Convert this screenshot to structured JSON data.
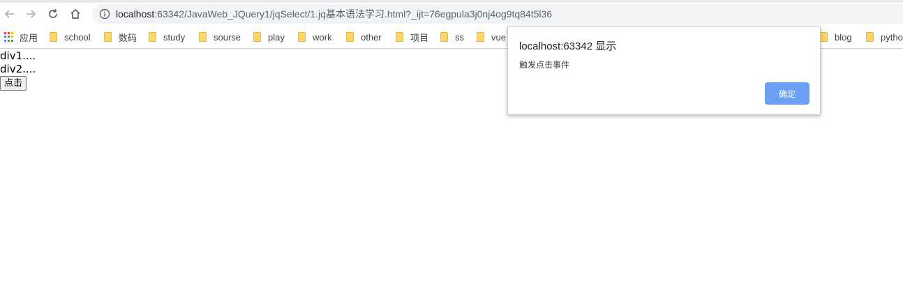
{
  "browser": {
    "url_host": "localhost",
    "url_rest": ":63342/JavaWeb_JQuery1/jqSelect/1.jq基本语法学习.html?_ijt=76egpula3j0nj4og9tq84t5l36",
    "back_icon": "arrow-left-icon",
    "forward_icon": "arrow-right-icon",
    "reload_icon": "reload-icon",
    "home_icon": "home-icon",
    "info_icon": "info-icon"
  },
  "bookmarks": {
    "apps_label": "应用",
    "items": [
      "school",
      "数码",
      "study",
      "sourse",
      "play",
      "work",
      "other",
      "项目",
      "ss",
      "vue",
      "blog",
      "pytho"
    ]
  },
  "page": {
    "div1": "div1....",
    "div2": "div2....",
    "button_label": "点击"
  },
  "dialog": {
    "title": "localhost:63342 显示",
    "message": "触发点击事件",
    "ok_label": "确定"
  },
  "colors": {
    "dialog_button": "#6ba0f5",
    "folder": "#fdd663"
  }
}
